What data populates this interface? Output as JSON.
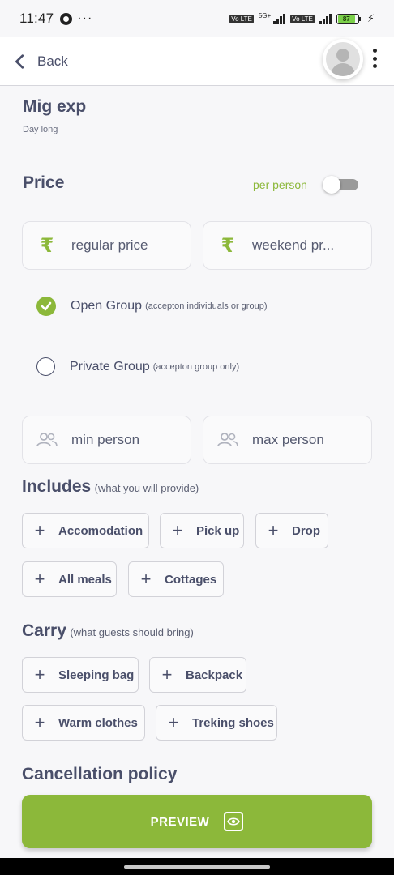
{
  "status_bar": {
    "time": "11:47",
    "dots": "···",
    "network_label": "5G+",
    "volte_label": "Vo LTE",
    "battery_level": "87",
    "battery_fraction": 0.87,
    "icons": [
      "whatsapp-icon",
      "signal-icon",
      "battery-icon",
      "charging-icon"
    ]
  },
  "header": {
    "back_label": "Back",
    "icons": [
      "chevron-left-icon",
      "avatar-placeholder",
      "more-vertical-icon"
    ]
  },
  "experience": {
    "title": "Mig exp",
    "subtitle": "Day long"
  },
  "price": {
    "title": "Price",
    "per_person_label": "per person",
    "per_person_enabled": false,
    "regular_placeholder": "regular price",
    "weekend_placeholder": "weekend pr...",
    "currency_symbol": "₹"
  },
  "group": {
    "options": [
      {
        "label": "Open Group",
        "note": "(accepton individuals or group)",
        "selected": true
      },
      {
        "label": "Private Group",
        "note": "(accepton group only)",
        "selected": false
      }
    ],
    "min_placeholder": "min person",
    "max_placeholder": "max person"
  },
  "includes": {
    "title": "Includes",
    "subtitle": "(what you will provide)",
    "items": [
      "Accomodation",
      "Pick up",
      "Drop",
      "All meals",
      "Cottages"
    ]
  },
  "carry": {
    "title": "Carry",
    "subtitle": "(what guests should bring)",
    "items": [
      "Sleeping bag",
      "Backpack",
      "Warm clothes",
      "Treking shoes"
    ]
  },
  "cancellation": {
    "title": "Cancellation policy"
  },
  "preview_button": {
    "label": "PREVIEW"
  },
  "colors": {
    "accent": "#8cb83a",
    "text": "#4a4f6a",
    "background": "#f7f7f9"
  }
}
